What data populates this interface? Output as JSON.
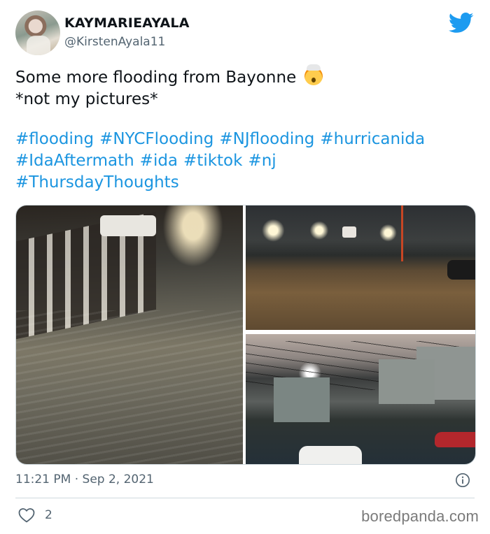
{
  "author": {
    "display_name": "KAYMARIEAYALA",
    "handle": "@KirstenAyala11"
  },
  "tweet": {
    "text_line_1": "Some more flooding from Bayonne",
    "emoji": "exploding-head",
    "text_line_2": "*not my pictures*",
    "hashtag_lines": [
      [
        "#flooding",
        "#NYCFlooding",
        "#NJflooding",
        "#hurricanida"
      ],
      [
        "#IdaAftermath",
        "#ida",
        "#tiktok",
        "#nj"
      ],
      [
        "#ThursdayThoughts"
      ]
    ],
    "timestamp": "11:21 PM · Sep 2, 2021",
    "like_count": "2"
  },
  "media": [
    {
      "description": "flooded street with railing at night"
    },
    {
      "description": "flooded parking lot with lights"
    },
    {
      "description": "flooded residential street with houses"
    }
  ],
  "watermark": "boredpanda.com",
  "colors": {
    "brand_blue": "#1d9bf0",
    "hashtag": "#1b95e0",
    "secondary_text": "#536471",
    "divider": "#cfd9de"
  }
}
